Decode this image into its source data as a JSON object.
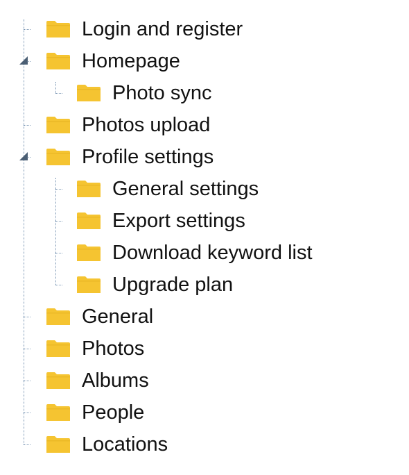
{
  "tree": {
    "items": [
      {
        "label": "Login and register",
        "icon": "folder-icon",
        "expanded": false,
        "children": []
      },
      {
        "label": "Homepage",
        "icon": "folder-icon",
        "expanded": true,
        "children": [
          {
            "label": "Photo sync",
            "icon": "folder-icon"
          }
        ]
      },
      {
        "label": "Photos upload",
        "icon": "folder-icon",
        "expanded": false,
        "children": []
      },
      {
        "label": "Profile settings",
        "icon": "folder-icon",
        "expanded": true,
        "children": [
          {
            "label": "General settings",
            "icon": "folder-icon"
          },
          {
            "label": "Export settings",
            "icon": "folder-icon"
          },
          {
            "label": "Download keyword list",
            "icon": "folder-icon"
          },
          {
            "label": "Upgrade plan",
            "icon": "folder-icon"
          }
        ]
      },
      {
        "label": "General",
        "icon": "folder-icon",
        "expanded": false,
        "children": []
      },
      {
        "label": "Photos",
        "icon": "folder-icon",
        "expanded": false,
        "children": []
      },
      {
        "label": "Albums",
        "icon": "folder-icon",
        "expanded": false,
        "children": []
      },
      {
        "label": "People",
        "icon": "folder-icon",
        "expanded": false,
        "children": []
      },
      {
        "label": "Locations",
        "icon": "folder-icon",
        "expanded": false,
        "children": []
      }
    ]
  },
  "colors": {
    "folder": "#f5c431",
    "folder_shadow": "#e1ad1c",
    "connector": "#7a96b4",
    "expander": "#4b5f74",
    "text": "#111111"
  }
}
